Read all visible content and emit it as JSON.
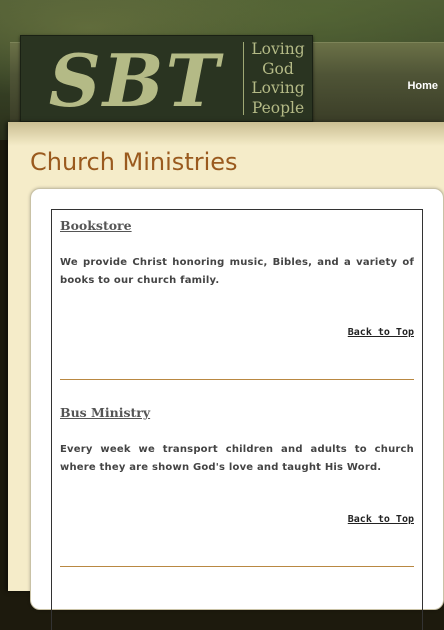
{
  "header": {
    "logo_text": "SBT",
    "tagline": [
      "Loving",
      "God",
      "Loving",
      "People"
    ],
    "nav": {
      "home_label": "Home"
    }
  },
  "main": {
    "title": "Church Ministries",
    "sections": [
      {
        "heading": "Bookstore",
        "text": "We provide Christ honoring music, Bibles, and a variety of books to our church family.",
        "back_link": "Back to Top"
      },
      {
        "heading": "Bus Ministry",
        "text": "Every week we transport children and adults to church where they are shown God's love and taught His Word.",
        "back_link": "Back to Top"
      }
    ]
  },
  "colors": {
    "title": "#9a5a1e",
    "page_background": "#f5ecc9",
    "logo_background": "#2a3421",
    "logo_text": "#b4ba86",
    "section_rule": "#b98842"
  }
}
